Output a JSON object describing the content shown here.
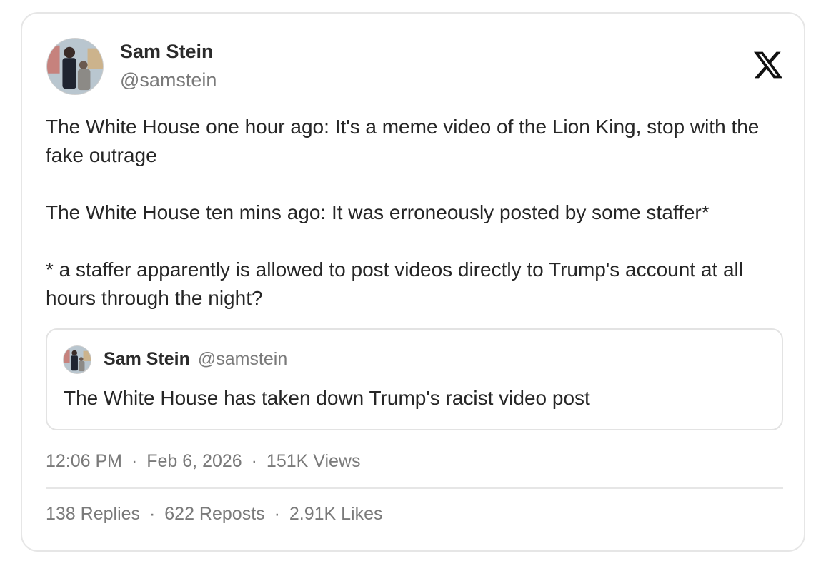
{
  "author": {
    "name": "Sam Stein",
    "handle": "@samstein"
  },
  "post": {
    "paragraphs": [
      "The White House one hour ago: It's a meme video of the Lion King, stop with the fake outrage",
      "The White House ten mins ago: It was erroneously posted by some staffer*",
      "* a staffer apparently is allowed to post videos directly to Trump's account at all hours through the night?"
    ]
  },
  "quoted_post": {
    "name": "Sam Stein",
    "handle": "@samstein",
    "text": "The White House has taken down Trump's racist video post"
  },
  "meta": {
    "time": "12:06 PM",
    "date": "Feb 6, 2026",
    "views": "151K Views",
    "separator": "·"
  },
  "stats": {
    "replies": "138 Replies",
    "reposts": "622 Reposts",
    "likes": "2.91K Likes"
  },
  "icons": {
    "platform": "x-logo-icon"
  },
  "colors": {
    "text": "#262626",
    "muted": "#7a7a7a",
    "border": "#e6e6e6"
  }
}
